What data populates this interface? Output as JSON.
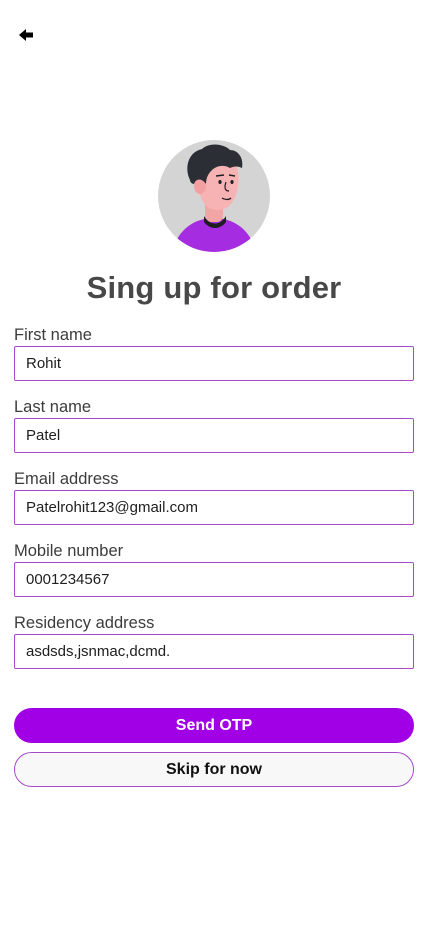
{
  "header": {
    "back_icon": "arrow-left-icon"
  },
  "profile": {
    "avatar_icon": "user-avatar-illustration"
  },
  "title": "Sing up for order",
  "form": {
    "first_name": {
      "label": "First name",
      "value": "Rohit"
    },
    "last_name": {
      "label": "Last name",
      "value": "Patel"
    },
    "email": {
      "label": "Email address",
      "value": "Patelrohit123@gmail.com"
    },
    "mobile": {
      "label": "Mobile number",
      "value": "0001234567"
    },
    "residency": {
      "label": "Residency address",
      "value": "asdsds,jsnmac,dcmd."
    }
  },
  "actions": {
    "send_otp_label": "Send OTP",
    "skip_label": "Skip for now"
  },
  "colors": {
    "accent": "#a100e6",
    "input_border": "#a64bc8",
    "title": "#484848",
    "avatar_bg": "#d4d4d4",
    "avatar_shirt": "#a52ce0"
  }
}
